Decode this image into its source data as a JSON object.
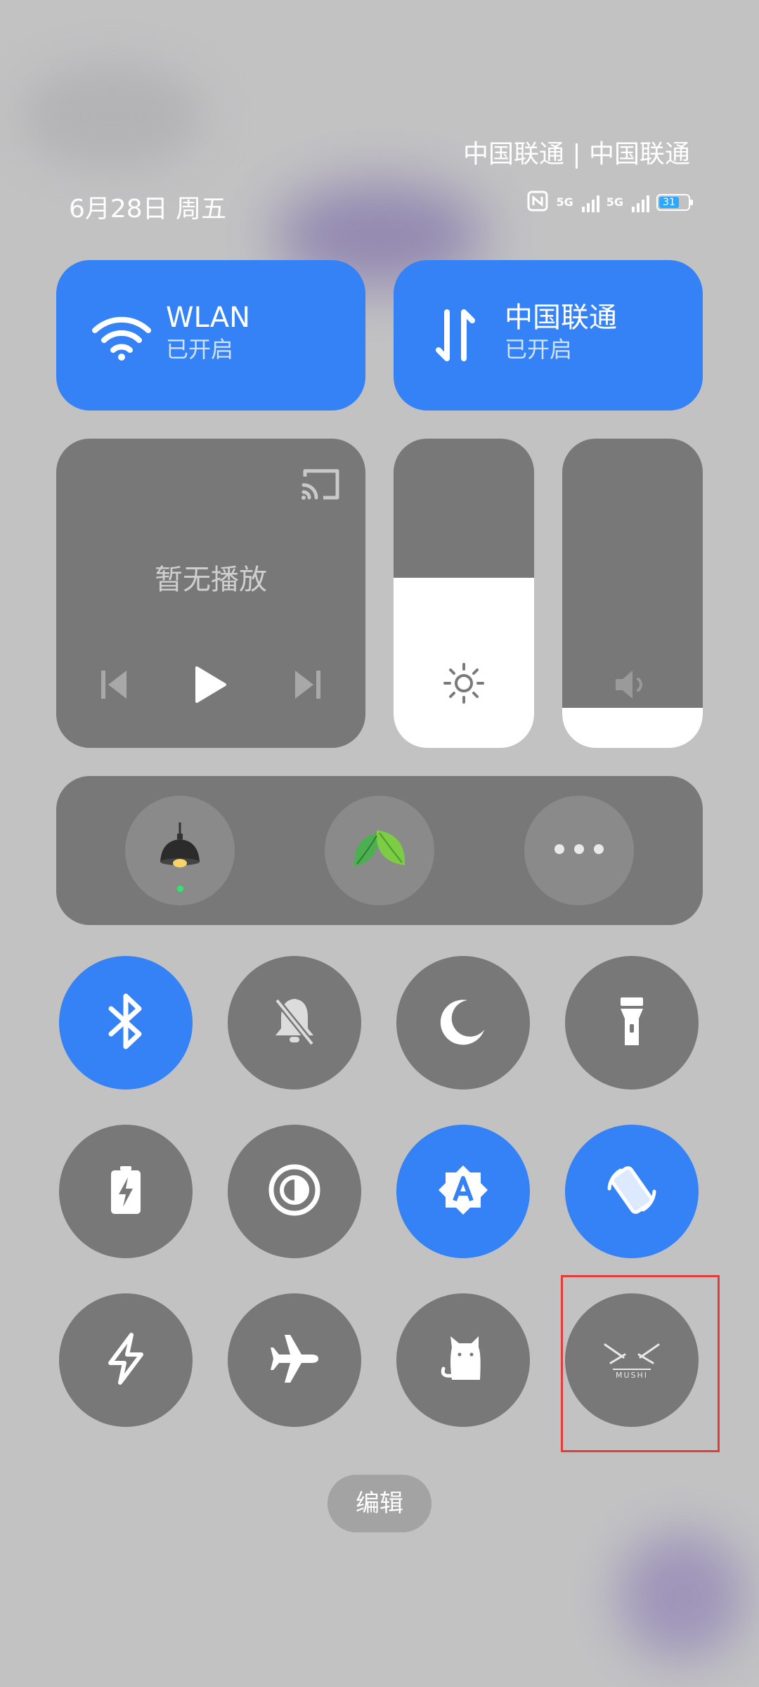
{
  "status": {
    "carrier": "中国联通 | 中国联通",
    "date": "6月28日 周五",
    "network_1": "5G",
    "network_2": "5G",
    "battery": "31",
    "battery_color": "#29a9ff"
  },
  "tiles": {
    "wlan": {
      "title": "WLAN",
      "subtitle": "已开启"
    },
    "mobile_data": {
      "title": "中国联通",
      "subtitle": "已开启"
    }
  },
  "media": {
    "empty_label": "暂无播放"
  },
  "sliders": {
    "brightness_level": 0.55,
    "volume_level": 0.13
  },
  "scenes": [
    {
      "icon": "lamp-icon",
      "active_indicator": true
    },
    {
      "icon": "leaf-icon"
    },
    {
      "icon": "more-icon"
    }
  ],
  "toggles": [
    {
      "icon": "bluetooth-icon",
      "active": true
    },
    {
      "icon": "mute-bell-icon",
      "active": false
    },
    {
      "icon": "moon-icon",
      "active": false
    },
    {
      "icon": "flashlight-icon",
      "active": false
    },
    {
      "icon": "battery-saver-icon",
      "active": false
    },
    {
      "icon": "dark-mode-icon",
      "active": false
    },
    {
      "icon": "auto-brightness-icon",
      "active": true
    },
    {
      "icon": "auto-rotate-icon",
      "active": true
    },
    {
      "icon": "performance-icon",
      "active": false
    },
    {
      "icon": "airplane-icon",
      "active": false
    },
    {
      "icon": "cat-app-icon",
      "active": false
    },
    {
      "icon": "mushi-app-icon",
      "active": false,
      "logo_text": "MUSHI"
    }
  ],
  "edit_button": "编辑",
  "colors": {
    "accent": "#3482f6",
    "tile_gray": "#787878",
    "background": "#c2c2c3",
    "highlight": "#e63b3b"
  }
}
